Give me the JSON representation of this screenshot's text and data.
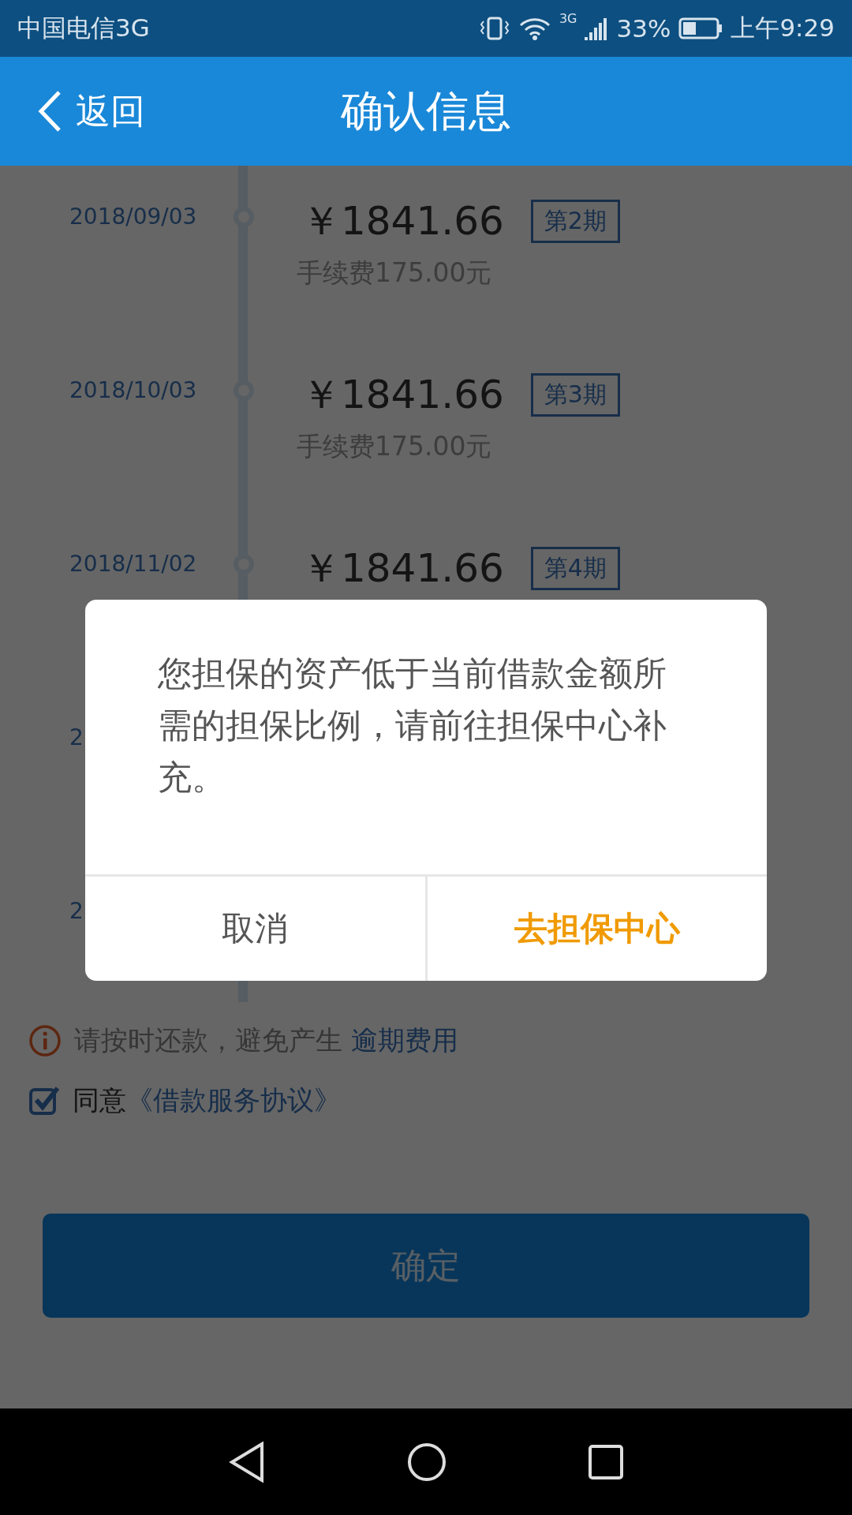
{
  "status_bar": {
    "carrier": "中国电信3G",
    "network": "3G",
    "battery": "33%",
    "time": "上午9:29"
  },
  "header": {
    "back": "返回",
    "title": "确认信息"
  },
  "installments": [
    {
      "date": "2018/09/03",
      "amount": "￥1841.66",
      "period": "第2期",
      "fee": "手续费175.00元"
    },
    {
      "date": "2018/10/03",
      "amount": "￥1841.66",
      "period": "第3期",
      "fee": "手续费175.00元"
    },
    {
      "date": "2018/11/02",
      "amount": "￥1841.66",
      "period": "第4期"
    },
    {
      "date": "2"
    },
    {
      "date": "2"
    }
  ],
  "notice": {
    "text": "请按时还款，避免产生 ",
    "link": "逾期费用"
  },
  "agreement": {
    "checked": true,
    "text": "同意",
    "link": "《借款服务协议》"
  },
  "confirm_button": "确定",
  "dialog": {
    "message": "您担保的资产低于当前借款金额所需的担保比例，请前往担保中心补充。",
    "buttons": [
      {
        "label": "取消",
        "kind": "cancel"
      },
      {
        "label": "去担保中心",
        "kind": "primary"
      }
    ]
  }
}
